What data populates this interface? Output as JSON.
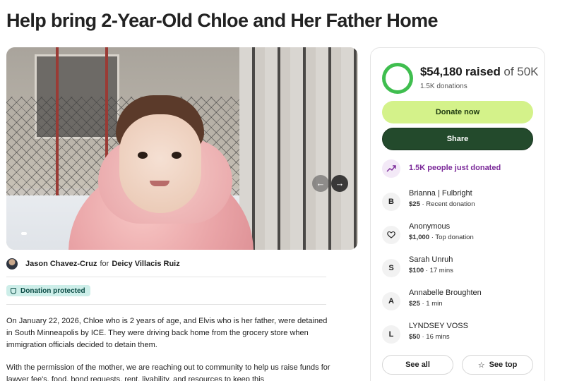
{
  "page": {
    "title": "Help bring 2-Year-Old Chloe and Her Father Home"
  },
  "hero": {
    "prev_icon": "←",
    "next_icon": "→"
  },
  "organizer": {
    "name": "Jason Chavez-Cruz",
    "for_word": "for",
    "beneficiary": "Deicy Villacis Ruiz"
  },
  "badge": {
    "label": "Donation protected"
  },
  "story": {
    "paragraphs": [
      "On January 22, 2026, Chloe who is 2 years of age, and Elvis who is her father, were detained in South Minneapolis by ICE. They were driving back home from the grocery store when immigration officials decided to detain them.",
      "With the permission of the mother, we are reaching out to community to help us raise funds for lawyer fee's, food, bond requests, rent, livability, and resources to keep this"
    ]
  },
  "card": {
    "amount": "$54,180",
    "raised_word": "raised",
    "goal": "of 50K",
    "donations": "1.5K donations",
    "progress": 1.0,
    "donate_label": "Donate now",
    "share_label": "Share",
    "trend_text": "1.5K people just donated",
    "donors": [
      {
        "initial": "B",
        "name": "Brianna | Fulbright",
        "amount": "$25",
        "note": " · Recent donation"
      },
      {
        "initial": "",
        "name": "Anonymous",
        "amount": "$1,000",
        "note": " · Top donation"
      },
      {
        "initial": "S",
        "name": "Sarah Unruh",
        "amount": "$100",
        "note": " · 17 mins"
      },
      {
        "initial": "A",
        "name": "Annabelle Broughten",
        "amount": "$25",
        "note": " · 1 min"
      },
      {
        "initial": "L",
        "name": "LYNDSEY VOSS",
        "amount": "$50",
        "note": " · 16 mins"
      }
    ],
    "see_all_label": "See all",
    "see_top_label": "See top"
  },
  "colors": {
    "progress_green": "#3fbe4f",
    "donate_bg": "#d4f28a",
    "share_bg": "#234a2c",
    "trend_purple": "#7b2a99",
    "badge_bg": "#cdeee9"
  }
}
